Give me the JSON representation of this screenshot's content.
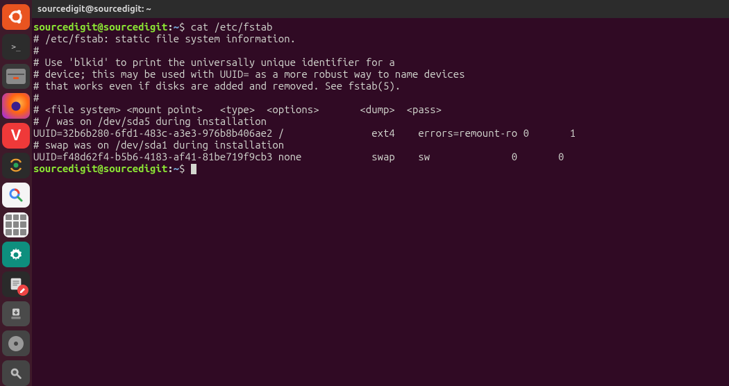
{
  "titlebar": {
    "title": "sourcedigit@sourcedigit: ~"
  },
  "prompt": {
    "user": "sourcedigit@sourcedigit",
    "colon": ":",
    "path": "~",
    "dollar": "$"
  },
  "command1": " cat /etc/fstab",
  "output": {
    "l1": "# /etc/fstab: static file system information.",
    "l2": "#",
    "l3": "# Use 'blkid' to print the universally unique identifier for a",
    "l4": "# device; this may be used with UUID= as a more robust way to name devices",
    "l5": "# that works even if disks are added and removed. See fstab(5).",
    "l6": "#",
    "l7": "# <file system> <mount point>   <type>  <options>       <dump>  <pass>",
    "l8": "# / was on /dev/sda5 during installation",
    "l9": "UUID=32b6b280-6fd1-483c-a3e3-976b8b406ae2 /               ext4    errors=remount-ro 0       1",
    "l10": "# swap was on /dev/sda1 during installation",
    "l11": "UUID=f48d62f4-b5b6-4183-af41-81be719f9cb3 none            swap    sw              0       0"
  },
  "command2": " ",
  "launcher": {
    "items": [
      {
        "name": "ubuntu-dash"
      },
      {
        "name": "terminal"
      },
      {
        "name": "files"
      },
      {
        "name": "firefox"
      },
      {
        "name": "vivaldi"
      },
      {
        "name": "sync"
      },
      {
        "name": "google-search"
      },
      {
        "name": "apps-grid"
      },
      {
        "name": "settings"
      },
      {
        "name": "text-editor"
      },
      {
        "name": "downloads"
      },
      {
        "name": "disks"
      },
      {
        "name": "screenshot"
      }
    ]
  }
}
